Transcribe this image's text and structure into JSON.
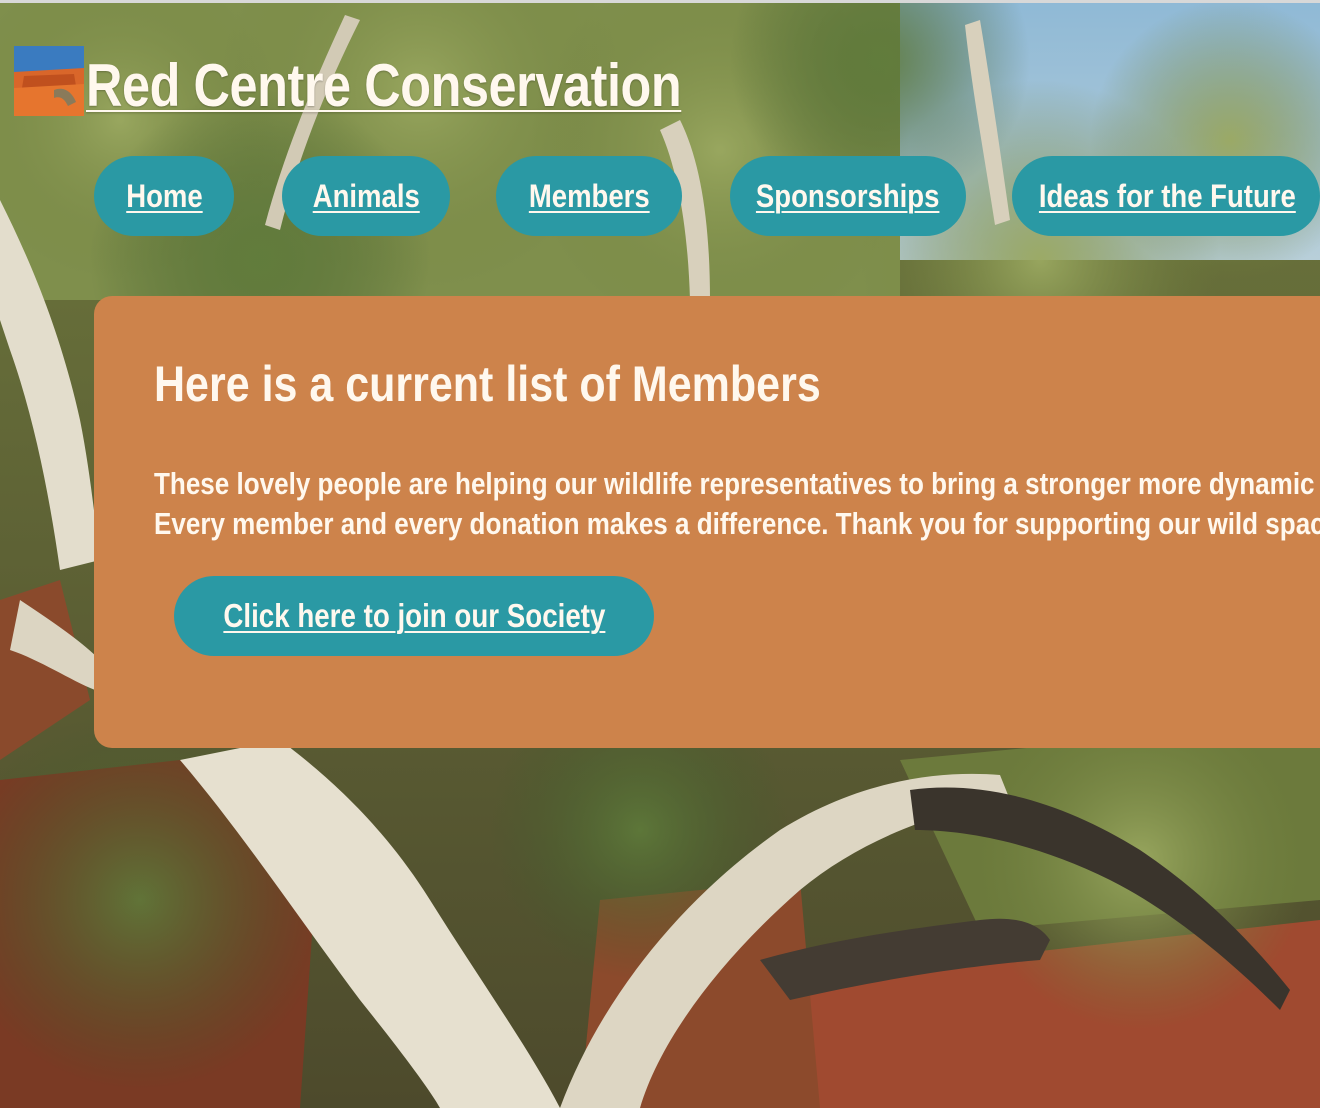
{
  "site": {
    "title": "Red Centre Conservation",
    "logo_icon": "outback-landscape-logo"
  },
  "nav": {
    "items": [
      {
        "label": "Home"
      },
      {
        "label": "Animals"
      },
      {
        "label": "Members"
      },
      {
        "label": "Sponsorships"
      },
      {
        "label": "Ideas for the Future"
      }
    ]
  },
  "main": {
    "heading": "Here is a current list of Members",
    "body_line_1": "These lovely people are helping our wildlife representatives to bring a stronger more dynamic",
    "body_line_2": "Every member and every donation makes a difference. Thank you for supporting our wild spac",
    "join_button_label": "Click here to join our Society"
  },
  "colors": {
    "nav_pill": "#2a99a4",
    "panel": "#cd834b",
    "text": "#fff8ee"
  }
}
